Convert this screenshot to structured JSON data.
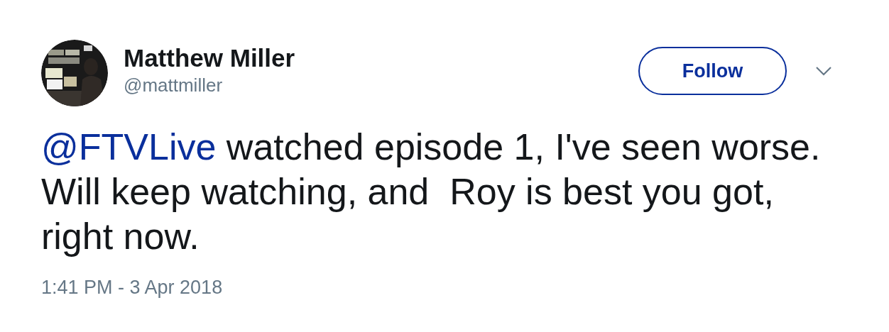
{
  "author": {
    "name": "Matthew Miller",
    "handle": "@mattmiller"
  },
  "follow_button": {
    "label": "Follow"
  },
  "tweet": {
    "mention": "@FTVLive",
    "text": " watched episode 1, I've seen worse. Will keep watching, and  Roy is best you got, right now."
  },
  "timestamp": "1:41 PM - 3 Apr 2018"
}
